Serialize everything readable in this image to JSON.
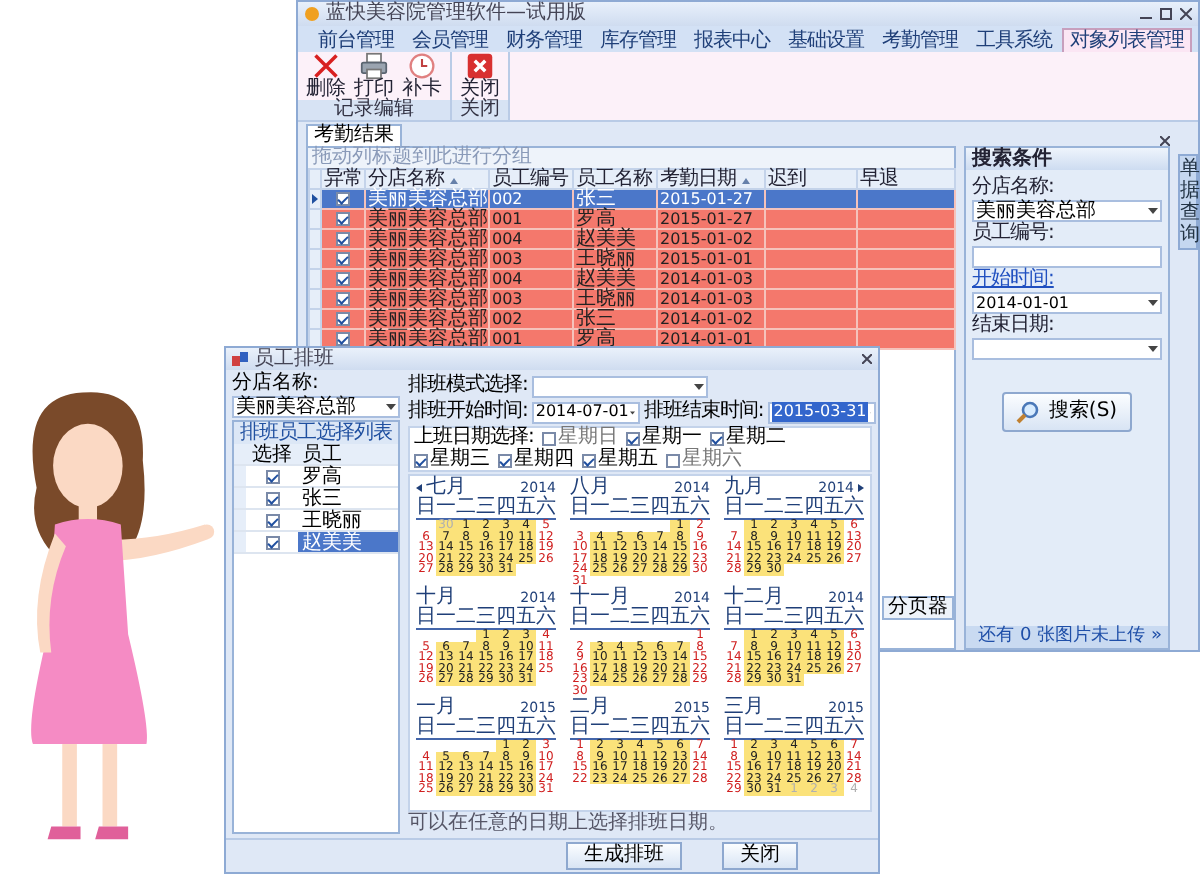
{
  "window": {
    "title": "蓝快美容院管理软件—试用版"
  },
  "menu_tabs": [
    {
      "label": "前台管理",
      "selected": false
    },
    {
      "label": "会员管理",
      "selected": false
    },
    {
      "label": "财务管理",
      "selected": false
    },
    {
      "label": "库存管理",
      "selected": false
    },
    {
      "label": "报表中心",
      "selected": false
    },
    {
      "label": "基础设置",
      "selected": false
    },
    {
      "label": "考勤管理",
      "selected": false
    },
    {
      "label": "工具系统",
      "selected": false
    },
    {
      "label": "对象列表管理",
      "selected": true
    }
  ],
  "ribbon": {
    "groups": [
      {
        "caption": "记录编辑",
        "buttons": [
          {
            "label": "删除",
            "kind": "delete"
          },
          {
            "label": "打印",
            "kind": "print"
          },
          {
            "label": "补卡",
            "kind": "clock"
          }
        ]
      },
      {
        "caption": "关闭",
        "buttons": [
          {
            "label": "关闭",
            "kind": "close"
          }
        ]
      }
    ]
  },
  "document_tab": {
    "label": "考勤结果"
  },
  "group_hint": "拖动列标题到此进行分组",
  "table": {
    "check_column": "异常",
    "columns": [
      "分店名称",
      "员工编号",
      "员工名称",
      "考勤日期",
      "迟到",
      "早退"
    ],
    "rows": [
      {
        "abnormal": true,
        "selected": true,
        "cells": [
          "美丽美容总部",
          "002",
          "张三",
          "2015-01-27"
        ]
      },
      {
        "abnormal": true,
        "selected": false,
        "cells": [
          "美丽美容总部",
          "001",
          "罗高",
          "2015-01-27"
        ]
      },
      {
        "abnormal": true,
        "selected": false,
        "cells": [
          "美丽美容总部",
          "004",
          "赵美美",
          "2015-01-02"
        ]
      },
      {
        "abnormal": true,
        "selected": false,
        "cells": [
          "美丽美容总部",
          "003",
          "王晓丽",
          "2015-01-01"
        ]
      },
      {
        "abnormal": true,
        "selected": false,
        "cells": [
          "美丽美容总部",
          "004",
          "赵美美",
          "2014-01-03"
        ]
      },
      {
        "abnormal": true,
        "selected": false,
        "cells": [
          "美丽美容总部",
          "003",
          "王晓丽",
          "2014-01-03"
        ]
      },
      {
        "abnormal": true,
        "selected": false,
        "cells": [
          "美丽美容总部",
          "002",
          "张三",
          "2014-01-02"
        ]
      },
      {
        "abnormal": true,
        "selected": false,
        "cells": [
          "美丽美容总部",
          "001",
          "罗高",
          "2014-01-01"
        ]
      }
    ]
  },
  "pager_label": "分页器",
  "search_panel": {
    "title": "搜索条件",
    "fields": [
      {
        "label": "分店名称:",
        "value": "美丽美容总部",
        "kind": "select",
        "link": false
      },
      {
        "label": "员工编号:",
        "kind": "text",
        "link": false
      },
      {
        "label": "开始时间:",
        "value": "2014-01-01",
        "kind": "select",
        "link": true
      },
      {
        "label": "结束日期:",
        "kind": "select",
        "link": false
      }
    ],
    "button": "搜索(S)"
  },
  "side_tab": "单据查询",
  "status": "还有 0 张图片未上传 »",
  "dialog": {
    "title": "员工排班",
    "branch": {
      "label": "分店名称:",
      "value": "美丽美容总部"
    },
    "employee_list": {
      "title": "排班员工选择列表",
      "columns": [
        "选择",
        "员工"
      ],
      "rows": [
        {
          "name": "罗高",
          "checked": true,
          "selected": false
        },
        {
          "name": "张三",
          "checked": true,
          "selected": false
        },
        {
          "name": "王晓丽",
          "checked": true,
          "selected": false
        },
        {
          "name": "赵美美",
          "checked": true,
          "selected": true
        }
      ]
    },
    "mode": {
      "label": "排班模式选择:"
    },
    "start": {
      "label": "排班开始时间:",
      "value": "2014-07-01"
    },
    "end": {
      "label": "排班结束时间:",
      "value": "2015-03-31"
    },
    "weekdays": {
      "label": "上班日期选择:",
      "items": [
        {
          "label": "星期日",
          "checked": false
        },
        {
          "label": "星期一",
          "checked": true
        },
        {
          "label": "星期二",
          "checked": true
        },
        {
          "label": "星期三",
          "checked": true
        },
        {
          "label": "星期四",
          "checked": true
        },
        {
          "label": "星期五",
          "checked": true
        },
        {
          "label": "星期六",
          "checked": false
        }
      ]
    },
    "months": [
      {
        "name": "七月",
        "year": "2014",
        "weekdays": "日一二三四五六",
        "before": [
          "30"
        ],
        "weeks": [
          [
            "1",
            "2",
            "3",
            "4",
            "5"
          ],
          [
            "6",
            "7",
            "8",
            "9",
            "10",
            "11",
            "12"
          ],
          [
            "13",
            "14",
            "15",
            "16",
            "17",
            "18",
            "19"
          ],
          [
            "20",
            "21",
            "22",
            "23",
            "24",
            "25",
            "26"
          ],
          [
            "27",
            "28",
            "29",
            "30",
            "31"
          ]
        ]
      },
      {
        "name": "八月",
        "year": "2014",
        "weekdays": "日一二三四五六",
        "weeks": [
          [
            "1",
            "2"
          ],
          [
            "3",
            "4",
            "5",
            "6",
            "7",
            "8",
            "9"
          ],
          [
            "10",
            "11",
            "12",
            "13",
            "14",
            "15",
            "16"
          ],
          [
            "17",
            "18",
            "19",
            "20",
            "21",
            "22",
            "23"
          ],
          [
            "24",
            "25",
            "26",
            "27",
            "28",
            "29",
            "30"
          ],
          [
            "31"
          ]
        ]
      },
      {
        "name": "九月",
        "year": "2014",
        "weekdays": "日一二三四五六",
        "weeks": [
          [
            "1",
            "2",
            "3",
            "4",
            "5",
            "6"
          ],
          [
            "7",
            "8",
            "9",
            "10",
            "11",
            "12",
            "13"
          ],
          [
            "14",
            "15",
            "16",
            "17",
            "18",
            "19",
            "20"
          ],
          [
            "21",
            "22",
            "23",
            "24",
            "25",
            "26",
            "27"
          ],
          [
            "28",
            "29",
            "30"
          ]
        ]
      },
      {
        "name": "十月",
        "year": "2014",
        "weekdays": "日一二三四五六",
        "weeks": [
          [
            "1",
            "2",
            "3",
            "4"
          ],
          [
            "5",
            "6",
            "7",
            "8",
            "9",
            "10",
            "11"
          ],
          [
            "12",
            "13",
            "14",
            "15",
            "16",
            "17",
            "18"
          ],
          [
            "19",
            "20",
            "21",
            "22",
            "23",
            "24",
            "25"
          ],
          [
            "26",
            "27",
            "28",
            "29",
            "30",
            "31"
          ]
        ]
      },
      {
        "name": "十一月",
        "year": "2014",
        "weekdays": "日一二三四五六",
        "weeks": [
          [
            "1"
          ],
          [
            "2",
            "3",
            "4",
            "5",
            "6",
            "7",
            "8"
          ],
          [
            "9",
            "10",
            "11",
            "12",
            "13",
            "14",
            "15"
          ],
          [
            "16",
            "17",
            "18",
            "19",
            "20",
            "21",
            "22"
          ],
          [
            "23",
            "24",
            "25",
            "26",
            "27",
            "28",
            "29"
          ],
          [
            "30"
          ]
        ]
      },
      {
        "name": "十二月",
        "year": "2014",
        "weekdays": "日一二三四五六",
        "weeks": [
          [
            "1",
            "2",
            "3",
            "4",
            "5",
            "6"
          ],
          [
            "7",
            "8",
            "9",
            "10",
            "11",
            "12",
            "13"
          ],
          [
            "14",
            "15",
            "16",
            "17",
            "18",
            "19",
            "20"
          ],
          [
            "21",
            "22",
            "23",
            "24",
            "25",
            "26",
            "27"
          ],
          [
            "28",
            "29",
            "30",
            "31"
          ]
        ]
      },
      {
        "name": "一月",
        "year": "2015",
        "weekdays": "日一二三四五六",
        "weeks": [
          [
            "1",
            "2",
            "3"
          ],
          [
            "4",
            "5",
            "6",
            "7",
            "8",
            "9",
            "10"
          ],
          [
            "11",
            "12",
            "13",
            "14",
            "15",
            "16",
            "17"
          ],
          [
            "18",
            "19",
            "20",
            "21",
            "22",
            "23",
            "24"
          ],
          [
            "25",
            "26",
            "27",
            "28",
            "29",
            "30",
            "31"
          ]
        ]
      },
      {
        "name": "二月",
        "year": "2015",
        "weekdays": "日一二三四五六",
        "weeks": [
          [
            "1",
            "2",
            "3",
            "4",
            "5",
            "6",
            "7"
          ],
          [
            "8",
            "9",
            "10",
            "11",
            "12",
            "13",
            "14"
          ],
          [
            "15",
            "16",
            "17",
            "18",
            "19",
            "20",
            "21"
          ],
          [
            "22",
            "23",
            "24",
            "25",
            "26",
            "27",
            "28"
          ]
        ]
      },
      {
        "name": "三月",
        "year": "2015",
        "weekdays": "日一二三四五六",
        "after": [
          "1",
          "2",
          "3",
          "4"
        ],
        "weeks": [
          [
            "1",
            "2",
            "3",
            "4",
            "5",
            "6",
            "7"
          ],
          [
            "8",
            "9",
            "10",
            "11",
            "12",
            "13",
            "14"
          ],
          [
            "15",
            "16",
            "17",
            "18",
            "19",
            "20",
            "21"
          ],
          [
            "22",
            "23",
            "24",
            "25",
            "26",
            "27",
            "28"
          ],
          [
            "29",
            "30",
            "31"
          ]
        ]
      }
    ],
    "hint": "可以在任意的日期上选择排班日期。",
    "buttons": [
      "生成排班",
      "关闭"
    ]
  }
}
